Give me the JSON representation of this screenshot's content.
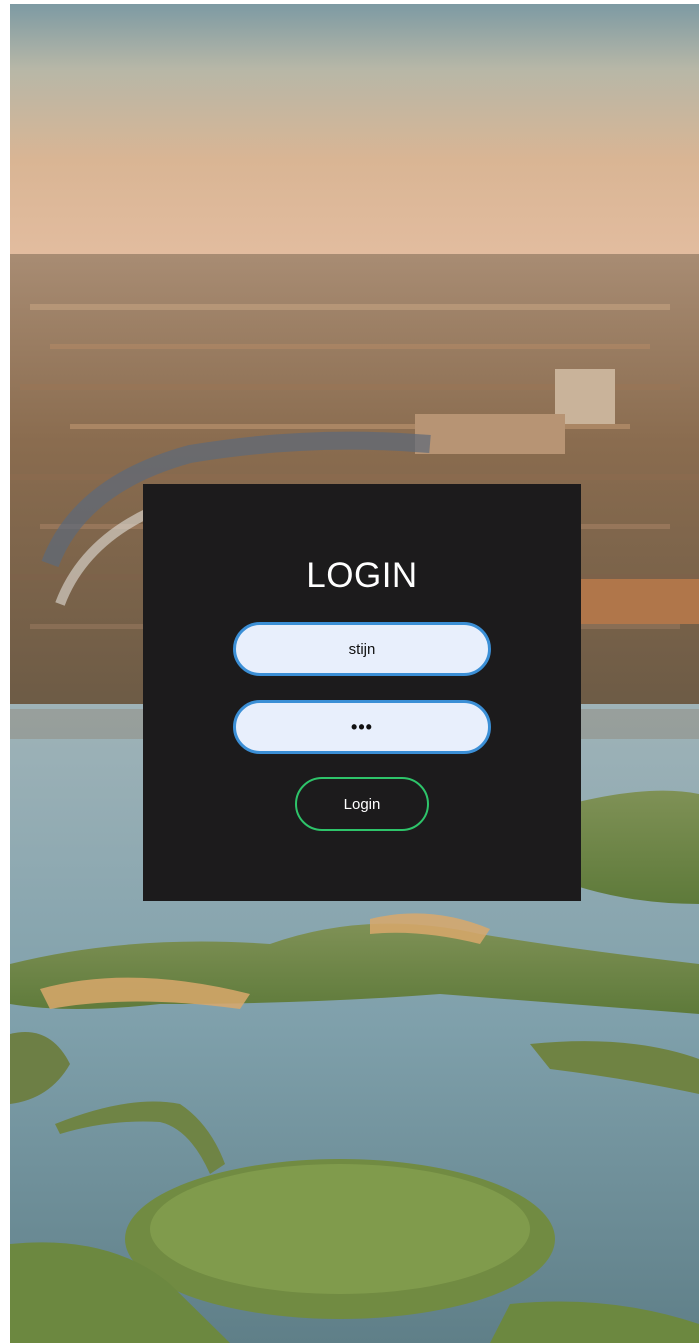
{
  "login": {
    "title": "LOGIN",
    "username_value": "stijn",
    "password_value": "•••",
    "button_label": "Login"
  },
  "colors": {
    "card_background": "#1c1b1c",
    "input_border": "#3b8fd6",
    "input_background": "#e8effc",
    "button_border": "#2ec46a",
    "text": "#ffffff"
  }
}
